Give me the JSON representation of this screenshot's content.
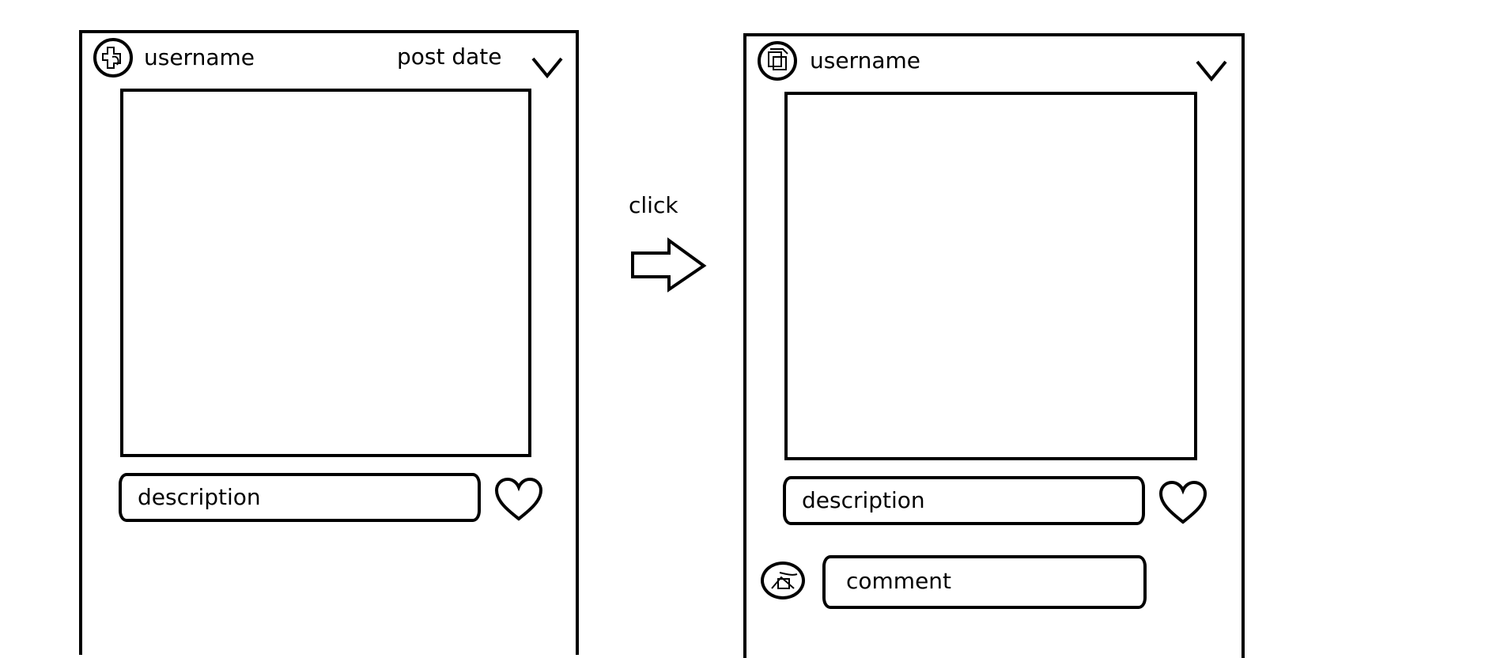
{
  "flow": {
    "transition_label": "click"
  },
  "left_card": {
    "username": "username",
    "post_date": "post date",
    "description": "description"
  },
  "right_card": {
    "username": "username",
    "description": "description",
    "comment": "comment"
  },
  "icons": {
    "avatar": "avatar-icon",
    "menu": "chevron-down-icon",
    "like": "heart-icon",
    "flow": "right-arrow-icon"
  },
  "colors": {
    "stroke": "#000000",
    "background": "#ffffff"
  }
}
